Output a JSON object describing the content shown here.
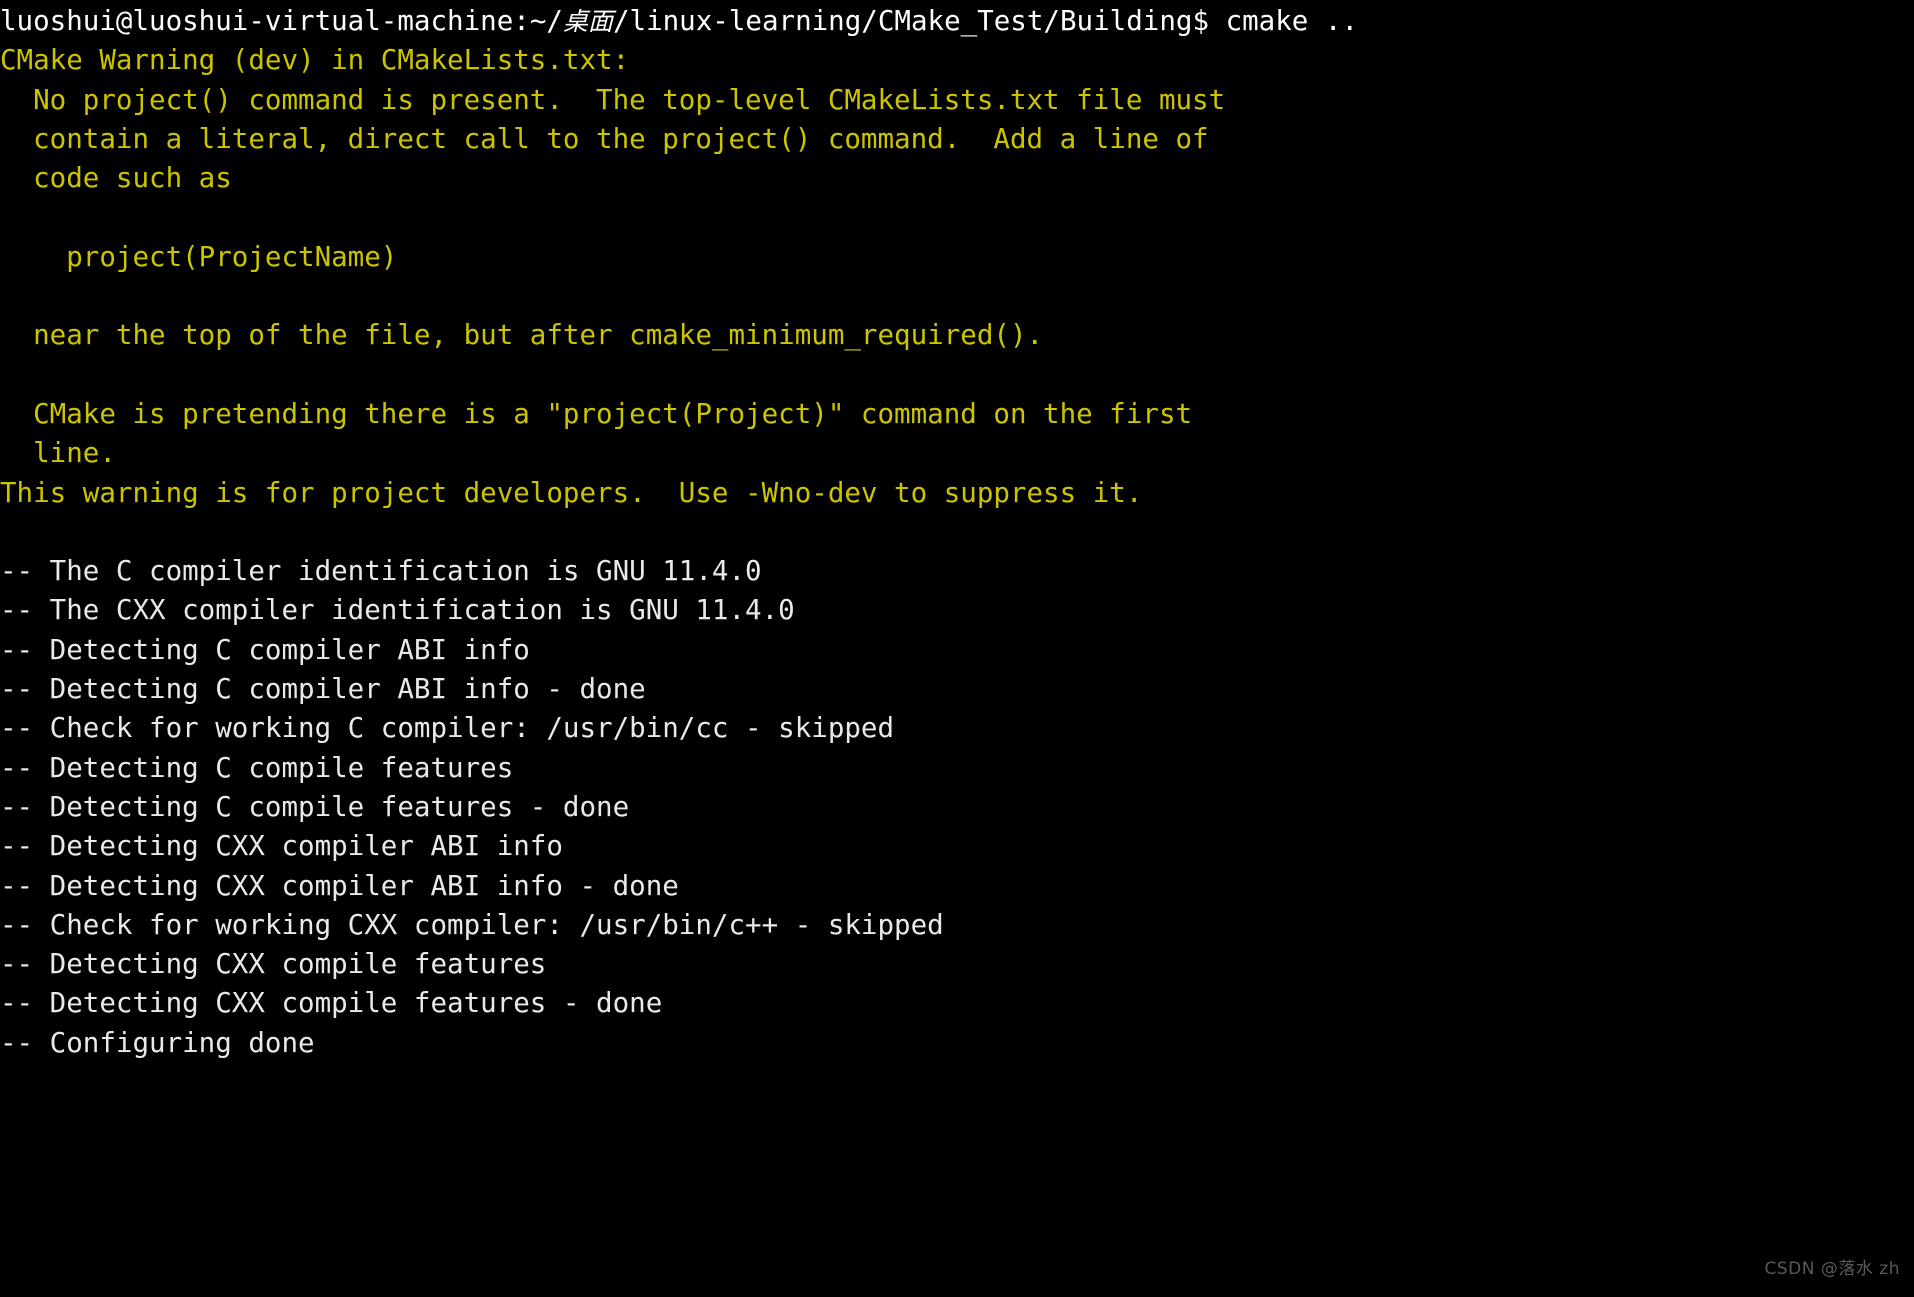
{
  "terminal": {
    "background_color": "#000000",
    "prompt_color": "#ffffff",
    "warning_color": "#cdc400",
    "output_color": "#e9e9e9",
    "prompt": {
      "user_host": "luoshui@luoshui-virtual-machine",
      "separator": ":",
      "path_prefix": "~/",
      "path_cjk": "桌面",
      "path_suffix": "/linux-learning/CMake_Test/Building",
      "sigil": "$ ",
      "command": "cmake .."
    },
    "lines": [
      {
        "id": "l00",
        "kind": "prompt",
        "text": ""
      },
      {
        "id": "l01",
        "kind": "warn",
        "text": "CMake Warning (dev) in CMakeLists.txt:"
      },
      {
        "id": "l02",
        "kind": "warn",
        "text": "  No project() command is present.  The top-level CMakeLists.txt file must"
      },
      {
        "id": "l03",
        "kind": "warn",
        "text": "  contain a literal, direct call to the project() command.  Add a line of"
      },
      {
        "id": "l04",
        "kind": "warn",
        "text": "  code such as"
      },
      {
        "id": "l05",
        "kind": "warn",
        "text": ""
      },
      {
        "id": "l06",
        "kind": "warn",
        "text": "    project(ProjectName)"
      },
      {
        "id": "l07",
        "kind": "warn",
        "text": ""
      },
      {
        "id": "l08",
        "kind": "warn",
        "text": "  near the top of the file, but after cmake_minimum_required()."
      },
      {
        "id": "l09",
        "kind": "warn",
        "text": ""
      },
      {
        "id": "l10",
        "kind": "warn",
        "text": "  CMake is pretending there is a \"project(Project)\" command on the first"
      },
      {
        "id": "l11",
        "kind": "warn",
        "text": "  line."
      },
      {
        "id": "l12",
        "kind": "warn",
        "text": "This warning is for project developers.  Use -Wno-dev to suppress it."
      },
      {
        "id": "l13",
        "kind": "out",
        "text": ""
      },
      {
        "id": "l14",
        "kind": "out",
        "text": "-- The C compiler identification is GNU 11.4.0"
      },
      {
        "id": "l15",
        "kind": "out",
        "text": "-- The CXX compiler identification is GNU 11.4.0"
      },
      {
        "id": "l16",
        "kind": "out",
        "text": "-- Detecting C compiler ABI info"
      },
      {
        "id": "l17",
        "kind": "out",
        "text": "-- Detecting C compiler ABI info - done"
      },
      {
        "id": "l18",
        "kind": "out",
        "text": "-- Check for working C compiler: /usr/bin/cc - skipped"
      },
      {
        "id": "l19",
        "kind": "out",
        "text": "-- Detecting C compile features"
      },
      {
        "id": "l20",
        "kind": "out",
        "text": "-- Detecting C compile features - done"
      },
      {
        "id": "l21",
        "kind": "out",
        "text": "-- Detecting CXX compiler ABI info"
      },
      {
        "id": "l22",
        "kind": "out",
        "text": "-- Detecting CXX compiler ABI info - done"
      },
      {
        "id": "l23",
        "kind": "out",
        "text": "-- Check for working CXX compiler: /usr/bin/c++ - skipped"
      },
      {
        "id": "l24",
        "kind": "out",
        "text": "-- Detecting CXX compile features"
      },
      {
        "id": "l25",
        "kind": "out",
        "text": "-- Detecting CXX compile features - done"
      },
      {
        "id": "l26",
        "kind": "out",
        "text": "-- Configuring done"
      }
    ]
  },
  "watermark": {
    "text": "CSDN @落水 zh"
  }
}
